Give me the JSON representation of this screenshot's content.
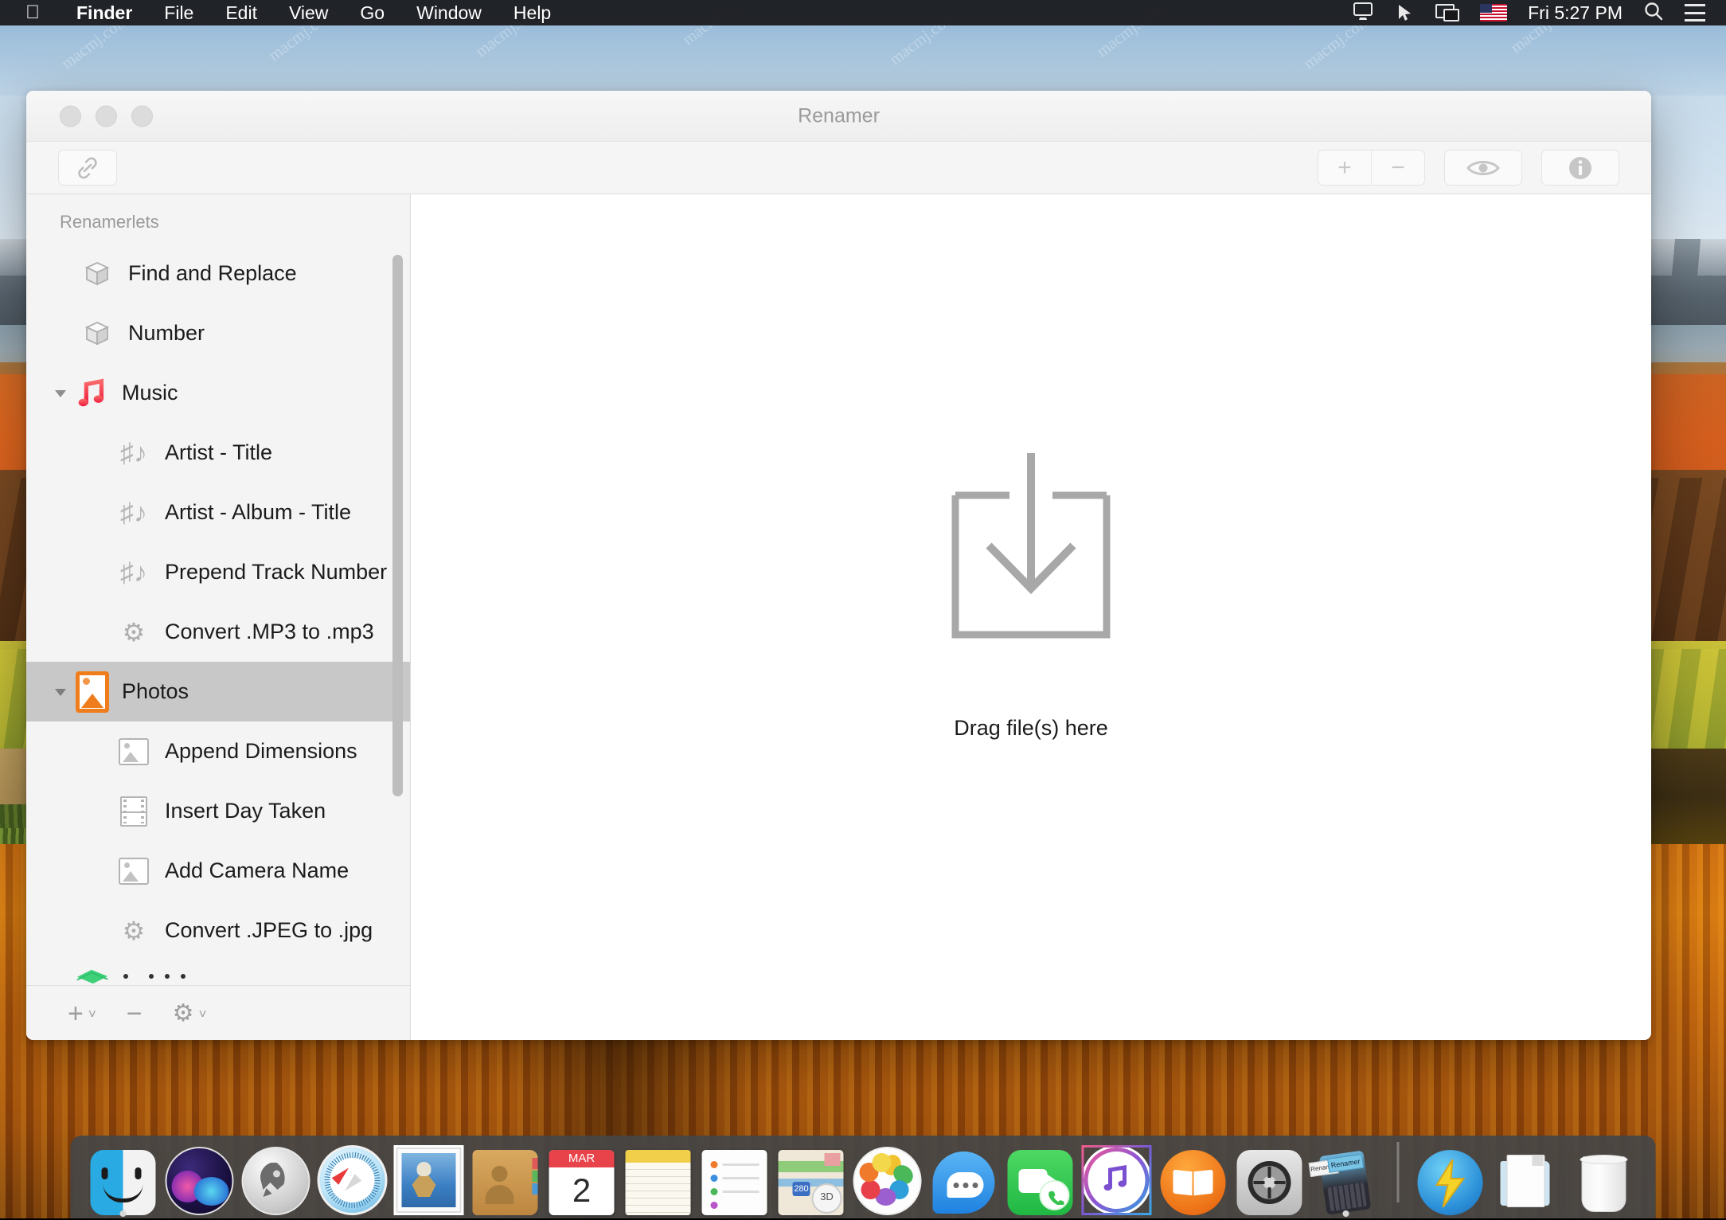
{
  "menubar": {
    "apple": "",
    "items": [
      {
        "label": "Finder",
        "bold": true
      },
      {
        "label": "File",
        "bold": false
      },
      {
        "label": "Edit",
        "bold": false
      },
      {
        "label": "View",
        "bold": false
      },
      {
        "label": "Go",
        "bold": false
      },
      {
        "label": "Window",
        "bold": false
      },
      {
        "label": "Help",
        "bold": false
      }
    ],
    "status": {
      "screen_share_icon": "screen-sharing-icon",
      "cursor_icon": "pointer-icon",
      "display_icon": "display-mirroring-icon",
      "flag_icon": "us-flag-icon",
      "clock": "Fri 5:27 PM",
      "search_icon": "spotlight-search-icon",
      "notification_icon": "notification-center-icon"
    }
  },
  "window": {
    "title": "Renamer",
    "traffic_lights": [
      "close",
      "minimize",
      "zoom"
    ],
    "toolbar": {
      "link_icon": "chain-link-icon",
      "add_label": "+",
      "remove_label": "−",
      "preview_icon": "eye-icon",
      "info_icon": "info-icon"
    }
  },
  "sidebar": {
    "header": "Renamerlets",
    "items": [
      {
        "label": "Find and Replace",
        "icon": "cube-icon",
        "level": 0,
        "selected": false,
        "group": false
      },
      {
        "label": "Number",
        "icon": "cube-icon",
        "level": 0,
        "selected": false,
        "group": false
      },
      {
        "label": "Music",
        "icon": "music-app-icon",
        "level": 0,
        "selected": false,
        "group": true,
        "expanded": true
      },
      {
        "label": "Artist - Title",
        "icon": "music-note-icon",
        "level": 1,
        "selected": false,
        "group": false
      },
      {
        "label": "Artist - Album - Title",
        "icon": "music-note-icon",
        "level": 1,
        "selected": false,
        "group": false
      },
      {
        "label": "Prepend Track Number",
        "icon": "music-note-icon",
        "level": 1,
        "selected": false,
        "group": false
      },
      {
        "label": "Convert .MP3 to .mp3",
        "icon": "gear-icon",
        "level": 1,
        "selected": false,
        "group": false
      },
      {
        "label": "Photos",
        "icon": "photos-app-icon",
        "level": 0,
        "selected": true,
        "group": true,
        "expanded": true
      },
      {
        "label": "Append Dimensions",
        "icon": "image-icon",
        "level": 1,
        "selected": false,
        "group": false
      },
      {
        "label": "Insert Day Taken",
        "icon": "film-icon",
        "level": 1,
        "selected": false,
        "group": false
      },
      {
        "label": "Add Camera Name",
        "icon": "image-icon",
        "level": 1,
        "selected": false,
        "group": false
      },
      {
        "label": "Convert .JPEG to .jpg",
        "icon": "gear-icon",
        "level": 1,
        "selected": false,
        "group": false
      }
    ],
    "footer": {
      "add_label": "+",
      "add_chevron": "˅",
      "remove_label": "−",
      "gear_label": "⚙",
      "gear_chevron": "˅"
    }
  },
  "content": {
    "drop_label": "Drag file(s) here",
    "drop_icon": "download-into-tray-icon"
  },
  "dock": {
    "items": [
      {
        "name": "Finder",
        "running": true
      },
      {
        "name": "Siri",
        "running": false
      },
      {
        "name": "Launchpad",
        "running": false
      },
      {
        "name": "Safari",
        "running": false
      },
      {
        "name": "Mail",
        "running": false
      },
      {
        "name": "Contacts",
        "running": false
      },
      {
        "name": "Calendar",
        "running": false,
        "month": "MAR",
        "day": "2"
      },
      {
        "name": "Notes",
        "running": false
      },
      {
        "name": "Reminders",
        "running": false
      },
      {
        "name": "Maps",
        "running": false,
        "badge": "3D",
        "shield": "280"
      },
      {
        "name": "Photos",
        "running": false
      },
      {
        "name": "Messages",
        "running": false
      },
      {
        "name": "FaceTime",
        "running": false
      },
      {
        "name": "iTunes",
        "running": false
      },
      {
        "name": "iBooks",
        "running": false
      },
      {
        "name": "System Preferences",
        "running": false
      },
      {
        "name": "Renamer",
        "running": true,
        "label": "Renamer"
      },
      {
        "name": "Downloads Stack",
        "running": false
      },
      {
        "name": "Documents",
        "running": false
      },
      {
        "name": "Trash",
        "running": false
      }
    ]
  },
  "watermark": {
    "text": "macmj.com"
  },
  "colors": {
    "menubar_bg": "#18181a",
    "window_bg": "#ffffff",
    "sidebar_bg": "#f4f4f4",
    "selection_bg": "#c8c8c8",
    "title_text": "#9b9b9b",
    "music_accent": "#f4374f",
    "photos_accent": "#f07d1b",
    "dock_bg": "#464646"
  }
}
